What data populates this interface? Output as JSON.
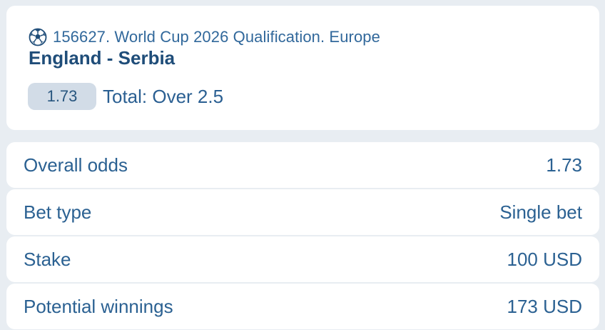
{
  "event": {
    "icon": "soccer-ball-icon",
    "league": "156627. World Cup 2026 Qualification. Europe",
    "match": "England - Serbia",
    "odds": "1.73",
    "selection": "Total: Over 2.5"
  },
  "summary": [
    {
      "label": "Overall odds",
      "value": "1.73"
    },
    {
      "label": "Bet type",
      "value": "Single bet"
    },
    {
      "label": "Stake",
      "value": "100 USD"
    },
    {
      "label": "Potential winnings",
      "value": "173 USD"
    }
  ],
  "colors": {
    "background": "#e8edf2",
    "card": "#ffffff",
    "text": "#2b6192",
    "title": "#1f4d79",
    "badge": "#d2dce7"
  }
}
